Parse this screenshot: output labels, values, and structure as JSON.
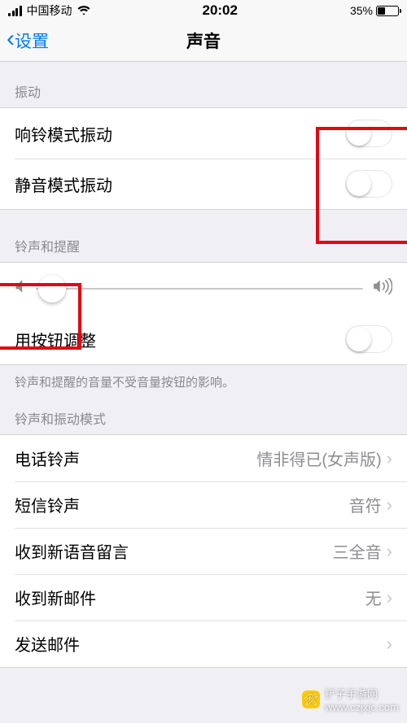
{
  "status": {
    "carrier": "中国移动",
    "time": "20:02",
    "battery_pct": "35%"
  },
  "nav": {
    "back_label": "设置",
    "title": "声音"
  },
  "sections": {
    "vibration": {
      "header": "振动",
      "ring_vibrate": "响铃模式振动",
      "silent_vibrate": "静音模式振动"
    },
    "ringer": {
      "header": "铃声和提醒",
      "adjust_with_buttons": "用按钮调整",
      "footer": "铃声和提醒的音量不受音量按钮的影响。"
    },
    "patterns": {
      "header": "铃声和振动模式",
      "items": {
        "ringtone": {
          "label": "电话铃声",
          "value": "情非得已(女声版)"
        },
        "text_tone": {
          "label": "短信铃声",
          "value": "音符"
        },
        "voicemail": {
          "label": "收到新语音留言",
          "value": "三全音"
        },
        "new_mail": {
          "label": "收到新邮件",
          "value": "无"
        },
        "sent_mail": {
          "label": "发送邮件",
          "value": ""
        }
      }
    }
  },
  "watermark": {
    "site": "铲子手游网",
    "url": "www.czjxjc.com"
  }
}
